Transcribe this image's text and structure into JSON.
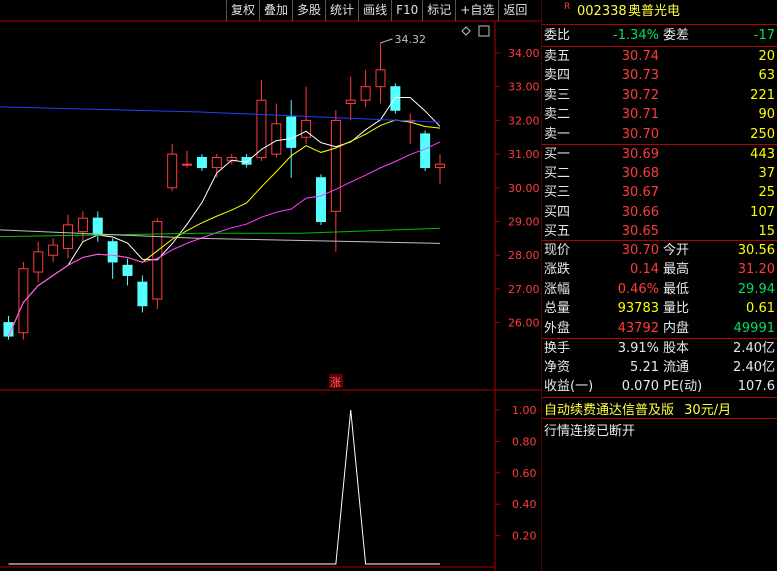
{
  "toolbar": {
    "items": [
      "复权",
      "叠加",
      "多股",
      "统计",
      "画线",
      "F10",
      "标记",
      "+自选",
      "返回"
    ]
  },
  "chart": {
    "peak_label": "34.32",
    "y_ticks": [
      "34.00",
      "33.00",
      "32.00",
      "31.00",
      "30.00",
      "29.00",
      "28.00",
      "27.00",
      "26.00"
    ],
    "indicator_ticks": [
      "1.00",
      "0.80",
      "0.60",
      "0.40",
      "0.20"
    ],
    "marker_label": "涨",
    "colors": {
      "up": "#ff3c3c",
      "down": "#54ffff",
      "ma5": "#ffffff",
      "ma10": "#ffff00",
      "ma20": "#ff40ff",
      "ma60": "#00c000",
      "ma120": "#c0c0c0",
      "ma250": "#2040ff",
      "frame": "#b00000"
    },
    "candles": [
      {
        "o": 26.0,
        "c": 25.6,
        "h": 26.2,
        "l": 25.5
      },
      {
        "o": 25.7,
        "c": 27.6,
        "h": 27.8,
        "l": 25.5
      },
      {
        "o": 27.5,
        "c": 28.1,
        "h": 28.4,
        "l": 27.2
      },
      {
        "o": 28.0,
        "c": 28.3,
        "h": 28.5,
        "l": 27.8
      },
      {
        "o": 28.2,
        "c": 28.9,
        "h": 29.2,
        "l": 27.9
      },
      {
        "o": 28.7,
        "c": 29.1,
        "h": 29.3,
        "l": 28.4
      },
      {
        "o": 29.1,
        "c": 28.6,
        "h": 29.3,
        "l": 28.4
      },
      {
        "o": 28.4,
        "c": 27.8,
        "h": 28.5,
        "l": 27.3
      },
      {
        "o": 27.7,
        "c": 27.4,
        "h": 27.9,
        "l": 27.1
      },
      {
        "o": 27.2,
        "c": 26.5,
        "h": 27.4,
        "l": 26.3
      },
      {
        "o": 26.7,
        "c": 29.0,
        "h": 29.1,
        "l": 26.4
      },
      {
        "o": 30.0,
        "c": 31.0,
        "h": 31.3,
        "l": 29.9
      },
      {
        "o": 30.7,
        "c": 30.7,
        "h": 31.1,
        "l": 30.6
      },
      {
        "o": 30.9,
        "c": 30.6,
        "h": 31.0,
        "l": 30.5
      },
      {
        "o": 30.6,
        "c": 30.9,
        "h": 31.0,
        "l": 30.3
      },
      {
        "o": 30.8,
        "c": 30.9,
        "h": 31.0,
        "l": 30.7
      },
      {
        "o": 30.9,
        "c": 30.7,
        "h": 31.0,
        "l": 30.6
      },
      {
        "o": 30.9,
        "c": 32.6,
        "h": 33.2,
        "l": 30.8
      },
      {
        "o": 31.0,
        "c": 31.9,
        "h": 32.5,
        "l": 30.9
      },
      {
        "o": 32.1,
        "c": 31.2,
        "h": 32.6,
        "l": 30.3
      },
      {
        "o": 31.5,
        "c": 32.0,
        "h": 33.0,
        "l": 31.3
      },
      {
        "o": 30.3,
        "c": 29.0,
        "h": 30.4,
        "l": 28.9
      },
      {
        "o": 29.3,
        "c": 32.0,
        "h": 32.3,
        "l": 28.1
      },
      {
        "o": 32.5,
        "c": 32.6,
        "h": 33.3,
        "l": 32.0
      },
      {
        "o": 32.6,
        "c": 33.0,
        "h": 33.5,
        "l": 32.4
      },
      {
        "o": 33.0,
        "c": 33.5,
        "h": 34.3,
        "l": 32.5
      },
      {
        "o": 33.0,
        "c": 32.3,
        "h": 33.1,
        "l": 32.2
      },
      {
        "o": 32.0,
        "c": 32.0,
        "h": 32.2,
        "l": 31.3
      },
      {
        "o": 31.6,
        "c": 30.6,
        "h": 31.7,
        "l": 30.5
      },
      {
        "o": 30.6,
        "c": 30.7,
        "h": 31.0,
        "l": 30.1
      }
    ],
    "indicator": [
      0,
      0,
      0,
      0,
      0,
      0,
      0,
      0,
      0,
      0,
      0,
      0,
      0,
      0,
      0,
      0,
      0,
      0,
      0,
      0,
      0,
      0,
      0,
      1,
      0,
      0,
      0,
      0,
      0,
      0
    ]
  },
  "stock": {
    "flag": "R",
    "code": "002338",
    "name": "奥普光电"
  },
  "quote": {
    "weibi_label": "委比",
    "weibi": "-1.34%",
    "weicha_label": "委差",
    "weicha": "-17",
    "asks": [
      {
        "label": "卖五",
        "price": "30.74",
        "vol": "20"
      },
      {
        "label": "卖四",
        "price": "30.73",
        "vol": "63"
      },
      {
        "label": "卖三",
        "price": "30.72",
        "vol": "221"
      },
      {
        "label": "卖二",
        "price": "30.71",
        "vol": "90"
      },
      {
        "label": "卖一",
        "price": "30.70",
        "vol": "250"
      }
    ],
    "bids": [
      {
        "label": "买一",
        "price": "30.69",
        "vol": "443"
      },
      {
        "label": "买二",
        "price": "30.68",
        "vol": "37"
      },
      {
        "label": "买三",
        "price": "30.67",
        "vol": "25"
      },
      {
        "label": "买四",
        "price": "30.66",
        "vol": "107"
      },
      {
        "label": "买五",
        "price": "30.65",
        "vol": "15"
      }
    ],
    "stats": [
      {
        "l1": "现价",
        "v1": "30.70",
        "l2": "今开",
        "v2": "30.56"
      },
      {
        "l1": "涨跌",
        "v1": "0.14",
        "l2": "最高",
        "v2": "31.20"
      },
      {
        "l1": "涨幅",
        "v1": "0.46%",
        "l2": "最低",
        "v2": "29.94"
      },
      {
        "l1": "总量",
        "v1": "93783",
        "l2": "量比",
        "v2": "0.61"
      },
      {
        "l1": "外盘",
        "v1": "43792",
        "l2": "内盘",
        "v2": "49991"
      }
    ],
    "fund": [
      {
        "l1": "换手",
        "v1": "3.91%",
        "l2": "股本",
        "v2": "2.40亿"
      },
      {
        "l1": "净资",
        "v1": "5.21",
        "l2": "流通",
        "v2": "2.40亿"
      },
      {
        "l1": "收益(一)",
        "v1": "0.070",
        "l2": "PE(动)",
        "v2": "107.6"
      }
    ]
  },
  "ad": {
    "text": "自动续费通达信普及版",
    "price": "30元/月"
  },
  "status": "行情连接已断开"
}
